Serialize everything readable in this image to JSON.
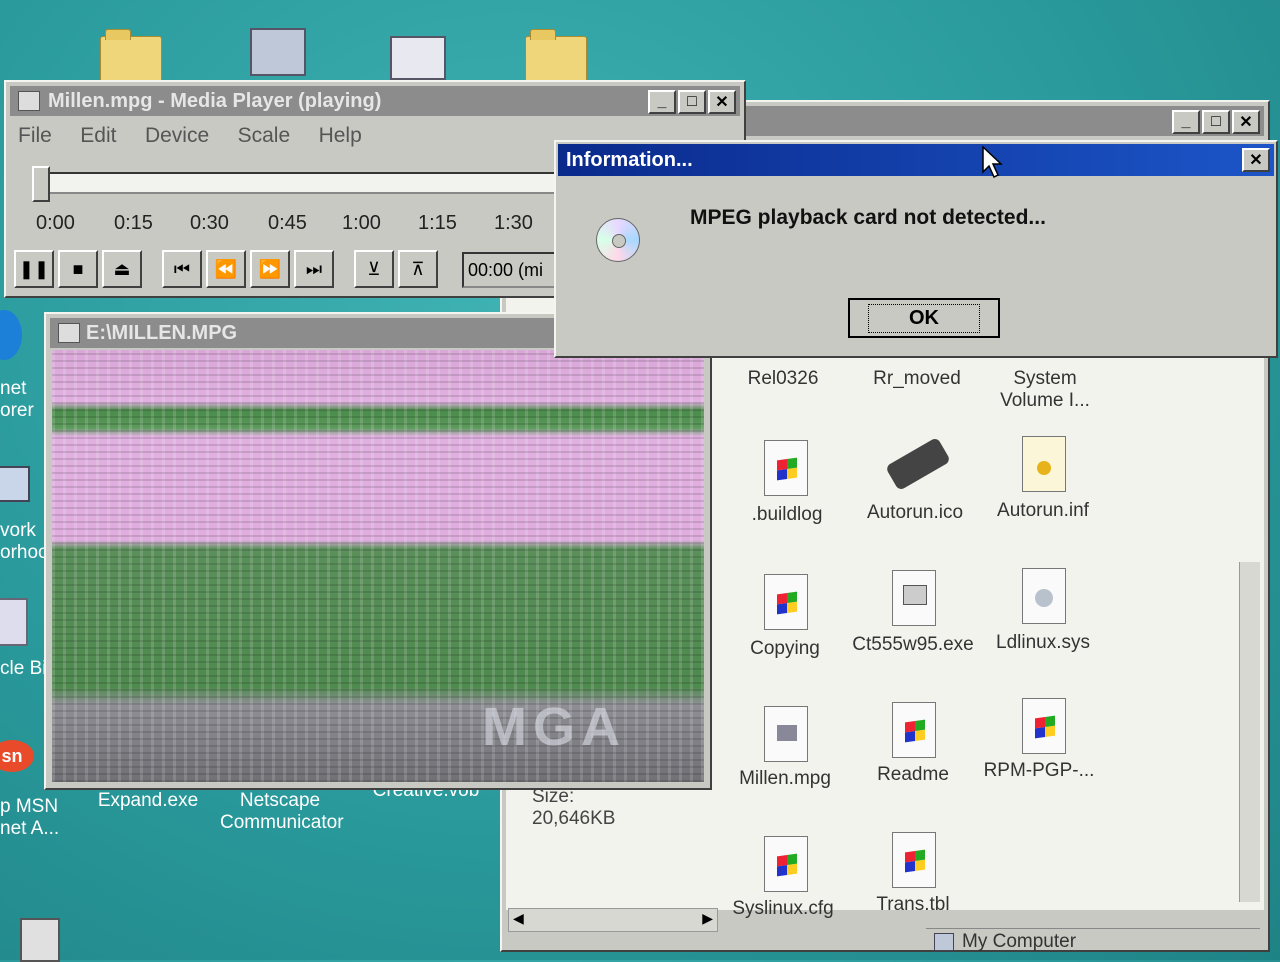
{
  "desktop": {
    "icons": [
      {
        "label": "net\norer"
      },
      {
        "label": "vork\norhoo"
      },
      {
        "label": "cle Bi"
      },
      {
        "label": "p MSN\nnet A..."
      },
      {
        "label": "Expand.exe"
      },
      {
        "label": "Netscape\nCommunicator"
      },
      {
        "label": "Creative.vob"
      }
    ]
  },
  "media_player": {
    "title": "Millen.mpg - Media Player (playing)",
    "menu": [
      "File",
      "Edit",
      "Device",
      "Scale",
      "Help"
    ],
    "ticks": [
      "0:00",
      "0:15",
      "0:30",
      "0:45",
      "1:00",
      "1:15",
      "1:30"
    ],
    "position_display": "00:00 (mi",
    "seek_position_fraction": 0.0
  },
  "video_window": {
    "title": "E:\\MILLEN.MPG",
    "overlay_text": "MGA"
  },
  "dialog": {
    "title": "Information...",
    "message": "MPEG playback card not detected...",
    "ok_label": "OK"
  },
  "explorer": {
    "details_size_label": "Size:",
    "details_size_value": "20,646KB",
    "files": [
      {
        "name": "Rel0326"
      },
      {
        "name": "Rr_moved"
      },
      {
        "name": "System\nVolume I..."
      },
      {
        "name": ".buildlog"
      },
      {
        "name": "Autorun.ico"
      },
      {
        "name": "Autorun.inf"
      },
      {
        "name": "Copying"
      },
      {
        "name": "Ct555w95.exe"
      },
      {
        "name": "Ldlinux.sys"
      },
      {
        "name": "Millen.mpg"
      },
      {
        "name": "Readme"
      },
      {
        "name": "RPM-PGP-..."
      },
      {
        "name": "Syslinux.cfg"
      },
      {
        "name": "Trans.tbl"
      }
    ],
    "status_location": "My Computer"
  },
  "colors": {
    "desktop": "#2a9a9c",
    "title_active": "#0a2a8c",
    "title_inactive": "#8c8c8c",
    "window_face": "#c9c9c4"
  }
}
